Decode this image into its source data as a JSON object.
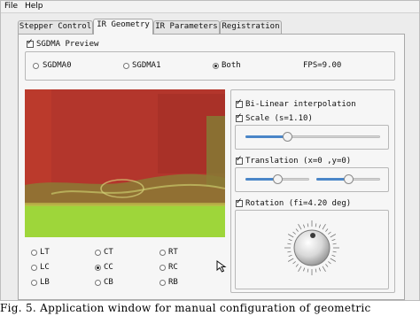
{
  "menubar": {
    "file": "File",
    "help": "Help"
  },
  "tabs": [
    {
      "label": "Stepper Control",
      "active": false
    },
    {
      "label": "IR Geometry",
      "active": true
    },
    {
      "label": "IR Parameters",
      "active": false
    },
    {
      "label": "Registration",
      "active": false
    }
  ],
  "sgdma": {
    "label": "SGDMA Preview",
    "checked": true,
    "options": [
      "SGDMA0",
      "SGDMA1",
      "Both"
    ],
    "selected": "Both",
    "fps": "FPS=9.00"
  },
  "alignment": {
    "options": [
      "LT",
      "CT",
      "RT",
      "LC",
      "CC",
      "RC",
      "LB",
      "CB",
      "RB"
    ],
    "selected": "CC"
  },
  "controls": {
    "bilinear_label": "Bi-Linear interpolation",
    "scale_label": "Scale (s=1.10)",
    "scale_value": 0.3,
    "translation_label": "Translation (x=0 ,y=0)",
    "translation_x_value": 0.5,
    "translation_y_value": 0.5,
    "rotation_label": "Rotation (fi=4.20 deg)",
    "rotation_deg": 4.2
  },
  "caption": "Fig. 5. Application window for manual configuration of geometric",
  "colors": {
    "accent": "#4a86c8",
    "image_top": "#b3362c",
    "image_bottom": "#9ed63a"
  }
}
